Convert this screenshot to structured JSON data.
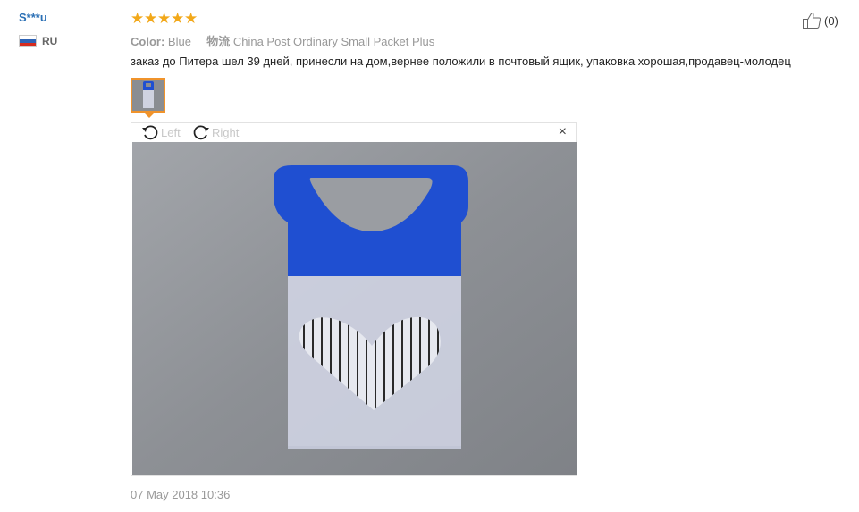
{
  "reviewer": {
    "name": "S***u",
    "country_code": "RU",
    "flag": "russia-flag"
  },
  "rating": {
    "stars": 5,
    "max": 5,
    "color": "#f2a81a"
  },
  "helpful": {
    "count": "(0)"
  },
  "meta": {
    "color_label": "Color:",
    "color_value": "Blue",
    "shipping_label": "物流",
    "shipping_value": "China Post Ordinary Small Packet Plus"
  },
  "review": {
    "text": "заказ до Питера шел 39 дней, принесли на дом,вернее положили в почтовый ящик, упаковка хорошая,продавец-молодец"
  },
  "viewer": {
    "rotate_left": "Left",
    "rotate_right": "Right",
    "close": "×"
  },
  "date": "07 May 2018 10:36",
  "colors": {
    "name_link": "#2a6fb5",
    "thumbnail_border": "#f0932b",
    "product_blue": "#1f4fd1"
  }
}
